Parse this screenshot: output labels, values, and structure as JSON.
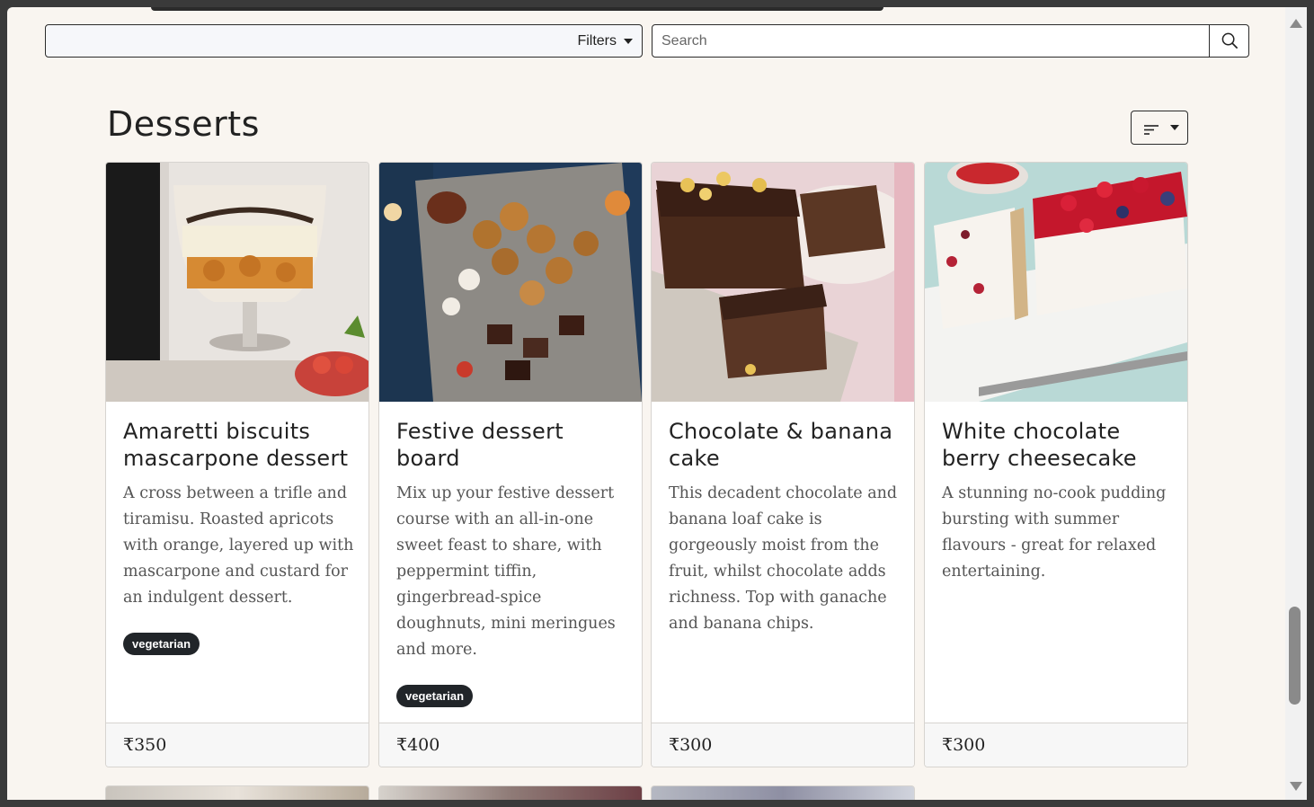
{
  "toolbar": {
    "filters_label": "Filters",
    "search_placeholder": "Search"
  },
  "section": {
    "title": "Desserts"
  },
  "cards": [
    {
      "title": "Amaretti biscuits mascarpone dessert",
      "description": "A cross between a trifle and tiramisu. Roasted apricots with orange, layered up with mascarpone and custard for an indulgent dessert.",
      "tag": "vegetarian",
      "price": "₹350"
    },
    {
      "title": "Festive dessert board",
      "description": "Mix up your festive dessert course with an all-in-one sweet feast to share, with peppermint tiffin, gingerbread-spice doughnuts, mini meringues and more.",
      "tag": "vegetarian",
      "price": "₹400"
    },
    {
      "title": "Chocolate & banana cake",
      "description": "This decadent chocolate and banana loaf cake is gorgeously moist from the fruit, whilst chocolate adds richness. Top with ganache and banana chips.",
      "tag": "",
      "price": "₹300"
    },
    {
      "title": "White chocolate berry cheesecake",
      "description": "A stunning no-cook pudding bursting with summer flavours - great for relaxed entertaining.",
      "tag": "",
      "price": "₹300"
    }
  ],
  "colors": {
    "page_background": "#f9f5f0",
    "badge_background": "#212529",
    "card_border": "#d7d4d0"
  }
}
